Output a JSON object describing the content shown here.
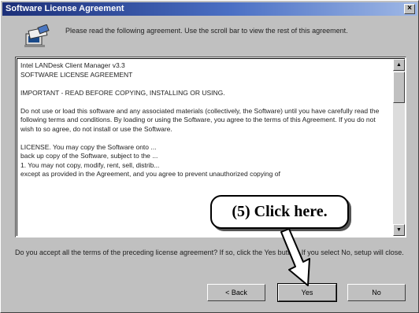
{
  "window": {
    "title": "Software License Agreement",
    "close_glyph": "×"
  },
  "icon": {
    "name": "computer-setup-icon"
  },
  "intro_text": "Please read the following agreement. Use the scroll bar to view the rest of this agreement.",
  "license": {
    "text": "Intel LANDesk Client Manager v3.3\nSOFTWARE LICENSE AGREEMENT\n\nIMPORTANT - READ BEFORE COPYING, INSTALLING OR USING.\n\nDo not use or load this software and any associated materials (collectively, the Software) until you have carefully read the following terms and conditions. By loading or using the Software, you agree to the terms of this Agreement. If you do not wish to so agree, do not install or use the Software.\n\nLICENSE. You may copy the Software onto ...\nback up copy of the Software, subject to the ...\n1. You may not copy, modify, rent, sell, distrib...\nexcept as provided in the Agreement, and you agree to prevent unauthorized copying of"
  },
  "question_text": "Do you accept all the terms of the preceding license agreement? If so, click the Yes button. If you select No, setup will close.",
  "buttons": {
    "back": "< Back",
    "yes": "Yes",
    "no": "No"
  },
  "callout": {
    "text": "(5)  Click here."
  }
}
